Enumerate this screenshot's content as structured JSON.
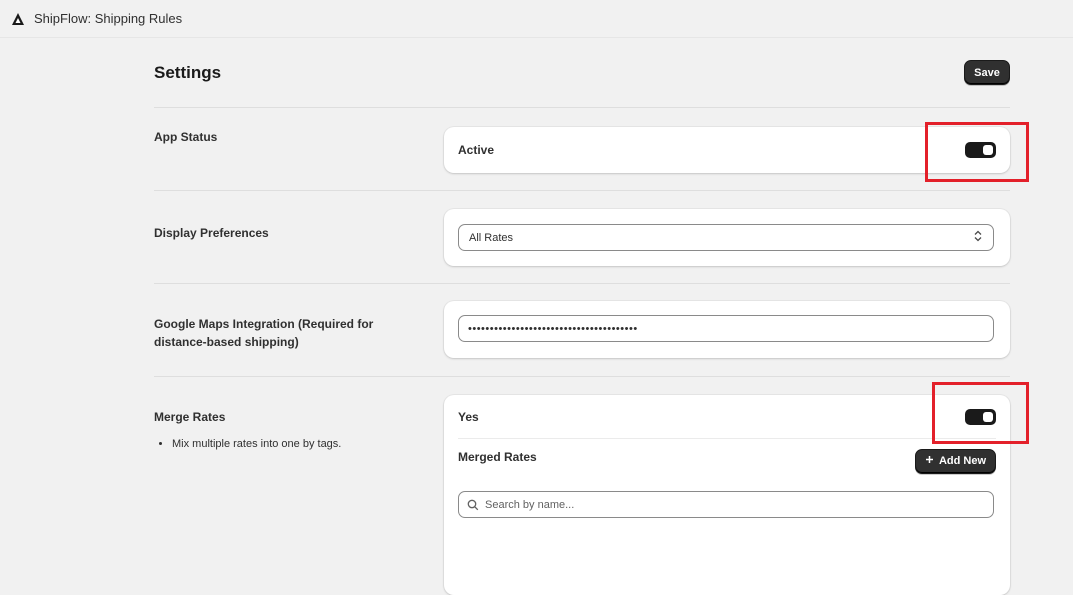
{
  "app": {
    "title": "ShipFlow: Shipping Rules"
  },
  "header": {
    "title": "Settings",
    "save_label": "Save"
  },
  "app_status": {
    "label": "App Status",
    "value_label": "Active",
    "toggle_on": true
  },
  "display_prefs": {
    "label": "Display Preferences",
    "selected": "All Rates"
  },
  "google_maps": {
    "label": "Google Maps Integration (Required for distance-based shipping)",
    "value": "•••••••••••••••••••••••••••••••••••••••"
  },
  "merge_rates": {
    "label": "Merge Rates",
    "bullets": [
      "Mix multiple rates into one by tags."
    ],
    "value_label": "Yes",
    "toggle_on": true,
    "merged_title": "Merged Rates",
    "add_label": "Add New",
    "search_placeholder": "Search by name..."
  },
  "colors": {
    "highlight": "#e3202a",
    "primary": "#303030"
  }
}
